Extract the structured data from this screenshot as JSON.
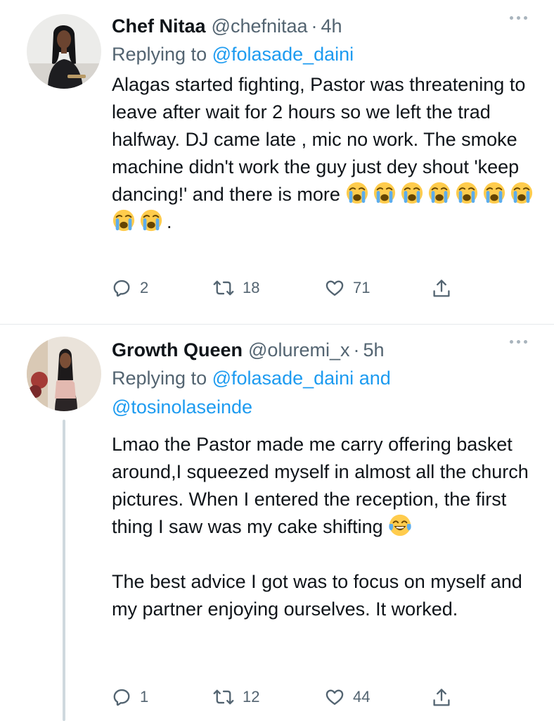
{
  "tweets": [
    {
      "display_name": "Chef Nitaa",
      "handle": "@chefnitaa",
      "separator": "·",
      "time": "4h",
      "reply_prefix": "Replying to",
      "reply_mentions": "@folasade_daini",
      "body": [
        "Alagas started fighting, Pastor was threatening to leave after wait for 2 hours so we left the trad halfway. DJ came late , mic no work. The smoke machine didn't work the guy just dey shout 'keep dancing!' and there is more"
      ],
      "body_suffix": ".",
      "emoji": "loudly-crying-face",
      "emoji_count": 9,
      "replies": "2",
      "retweets": "18",
      "likes": "71"
    },
    {
      "display_name": "Growth Queen",
      "handle": "@oluremi_x",
      "separator": "·",
      "time": "5h",
      "reply_prefix": "Replying to",
      "reply_mentions_1": "@folasade_daini",
      "reply_and": "and",
      "reply_mentions_2": "@tosinolaseinde",
      "body_1": "Lmao the Pastor made me carry offering basket around,I squeezed myself in almost all the church pictures. When I entered the reception, the first thing I saw was my cake shifting",
      "body_1_emoji": "face-with-tears-of-joy",
      "body_2": "The best advice I got was to focus on myself and my partner enjoying ourselves. It worked.",
      "replies": "1",
      "retweets": "12",
      "likes": "44"
    }
  ],
  "colors": {
    "text": "#0f1419",
    "secondary": "#536471",
    "link": "#1d9bf0",
    "divider": "#e6e9ec",
    "thread_line": "#cfd9de"
  },
  "icons": [
    "more-icon",
    "reply-icon",
    "retweet-icon",
    "like-icon",
    "share-icon"
  ]
}
